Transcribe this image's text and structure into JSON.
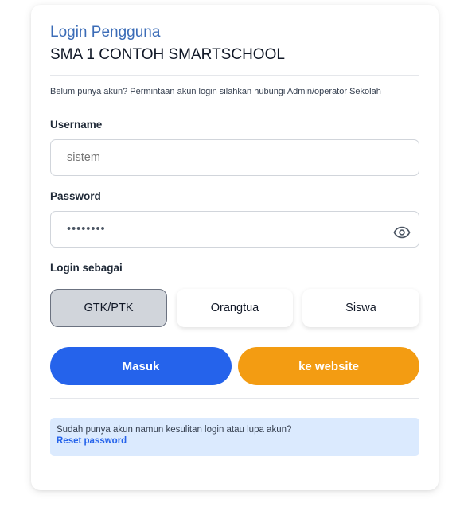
{
  "header": {
    "title": "Login Pengguna",
    "school_name": "SMA 1 CONTOH SMARTSCHOOL"
  },
  "notice": "Belum punya akun? Permintaan akun login silahkan hubungi Admin/operator Sekolah",
  "form": {
    "username_label": "Username",
    "username_placeholder": "sistem",
    "password_label": "Password",
    "password_value": "••••••••",
    "login_as_label": "Login sebagai",
    "roles": [
      "GTK/PTK",
      "Orangtua",
      "Siswa"
    ],
    "selected_role": "GTK/PTK"
  },
  "buttons": {
    "login": "Masuk",
    "website": "ke website"
  },
  "help": {
    "text": "Sudah punya akun namun kesulitan login atau lupa akun?",
    "link": "Reset password"
  },
  "colors": {
    "title": "#3b6cb7",
    "login_button": "#2563eb",
    "website_button": "#f39c12",
    "help_background": "#dbeafe",
    "link": "#2563eb"
  },
  "icons": {
    "password_toggle": "eye-icon"
  }
}
